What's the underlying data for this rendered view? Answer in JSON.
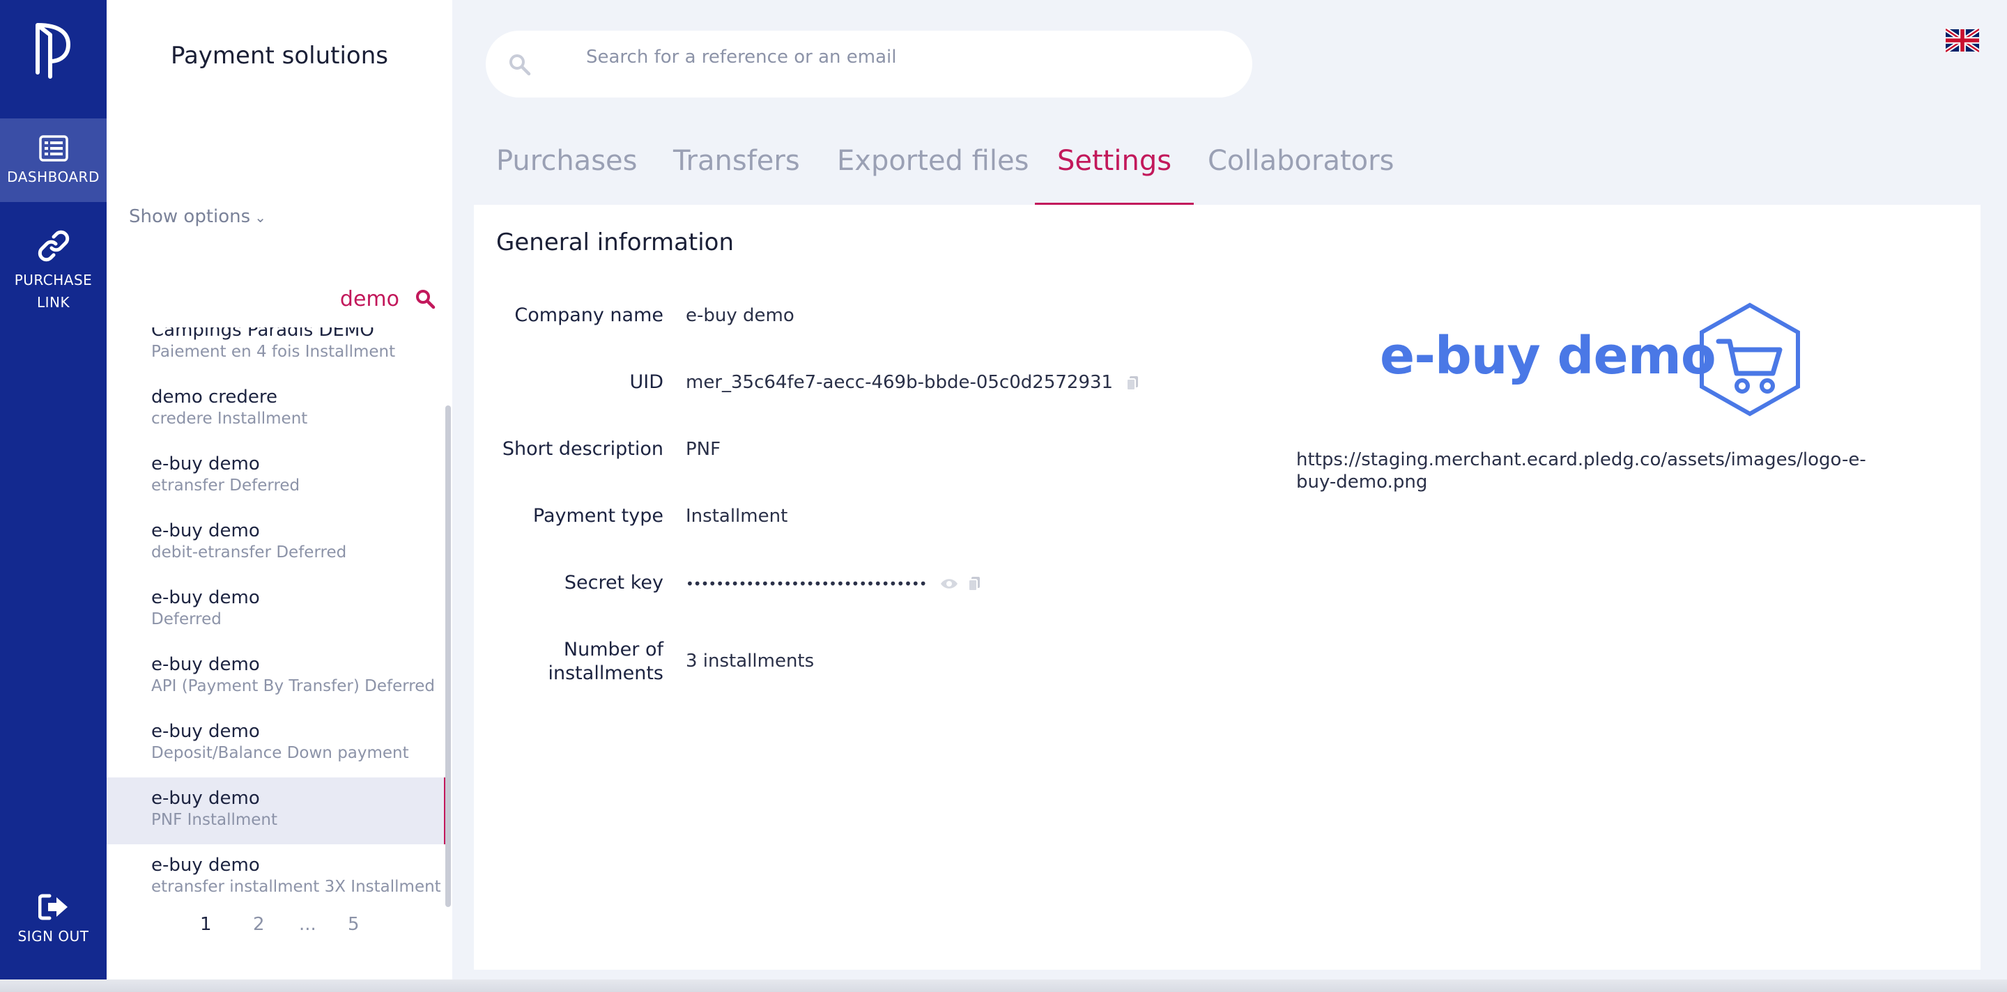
{
  "nav": {
    "dashboard_label": "DASHBOARD",
    "purchase_link_label_1": "PURCHASE",
    "purchase_link_label_2": "LINK",
    "sign_out_label": "SIGN OUT"
  },
  "sidebar": {
    "title": "Payment solutions",
    "show_options": "Show options",
    "search_value": "demo",
    "items": [
      {
        "name": "Campings Paradis DEMO",
        "sub": "Paiement en 4 fois Installment"
      },
      {
        "name": "demo credere",
        "sub": "credere Installment"
      },
      {
        "name": "e-buy demo",
        "sub": "etransfer Deferred"
      },
      {
        "name": "e-buy demo",
        "sub": "debit-etransfer Deferred"
      },
      {
        "name": "e-buy demo",
        "sub": "Deferred"
      },
      {
        "name": "e-buy demo",
        "sub": "API (Payment By Transfer) Deferred"
      },
      {
        "name": "e-buy demo",
        "sub": "Deposit/Balance Down payment"
      },
      {
        "name": "e-buy demo",
        "sub": "PNF Installment"
      },
      {
        "name": "e-buy demo",
        "sub": "etransfer installment 3X Installment"
      }
    ],
    "pager": [
      "1",
      "2",
      "...",
      "5"
    ]
  },
  "search": {
    "placeholder": "Search for a reference or an email"
  },
  "tabs": [
    "Purchases",
    "Transfers",
    "Exported files",
    "Settings",
    "Collaborators"
  ],
  "general": {
    "heading": "General information",
    "company_name_label": "Company name",
    "company_name": "e-buy demo",
    "uid_label": "UID",
    "uid": "mer_35c64fe7-aecc-469b-bbde-05c0d2572931",
    "short_description_label": "Short description",
    "short_description": "PNF",
    "payment_type_label": "Payment type",
    "payment_type": "Installment",
    "secret_key_label": "Secret key",
    "secret_key": "••••••••••••••••••••••••••••••••",
    "installments_label_1": "Number of",
    "installments_label_2": "installments",
    "installments": "3 installments",
    "logo_text": "e-buy demo",
    "logo_url": "https://staging.merchant.ecard.pledg.co/assets/images/logo-e-buy-demo.png"
  },
  "colors": {
    "rail": "#13298f",
    "accent": "#c2185b",
    "brand_blue": "#4a78e6"
  },
  "icons": [
    "pledg-logo-icon",
    "dashboard-icon",
    "link-icon",
    "sign-out-icon",
    "search-icon",
    "uk-flag-icon",
    "copy-icon",
    "eye-icon",
    "cart-icon"
  ]
}
